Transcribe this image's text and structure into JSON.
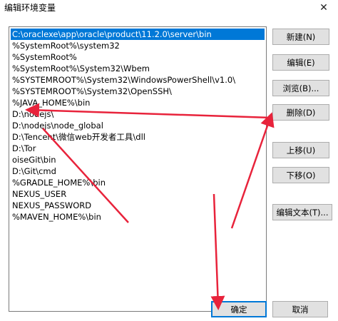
{
  "window": {
    "title": "编辑环境变量",
    "close_glyph": "✕"
  },
  "list": {
    "items": [
      "C:\\oraclexe\\app\\oracle\\product\\11.2.0\\server\\bin",
      "%SystemRoot%\\system32",
      "%SystemRoot%",
      "%SystemRoot%\\System32\\Wbem",
      "%SYSTEMROOT%\\System32\\WindowsPowerShell\\v1.0\\",
      "%SYSTEMROOT%\\System32\\OpenSSH\\",
      "%JAVA_HOME%\\bin",
      "D:\\nodejs\\",
      "D:\\nodejs\\node_global",
      "D:\\Tencent\\微信web开发者工具\\dll",
      "D:\\Tor",
      "oiseGit\\bin",
      "D:\\Git\\cmd",
      "%GRADLE_HOME%\\bin",
      "NEXUS_USER",
      "NEXUS_PASSWORD",
      "%MAVEN_HOME%\\bin"
    ],
    "selected_index": 0
  },
  "buttons": {
    "new": "新建(N)",
    "edit": "编辑(E)",
    "browse": "浏览(B)...",
    "delete": "删除(D)",
    "move_up": "上移(U)",
    "move_down": "下移(O)",
    "edit_text": "编辑文本(T)...",
    "ok": "确定",
    "cancel": "取消"
  },
  "colors": {
    "selection": "#0078d7",
    "annotation_arrow": "#e8233b"
  }
}
